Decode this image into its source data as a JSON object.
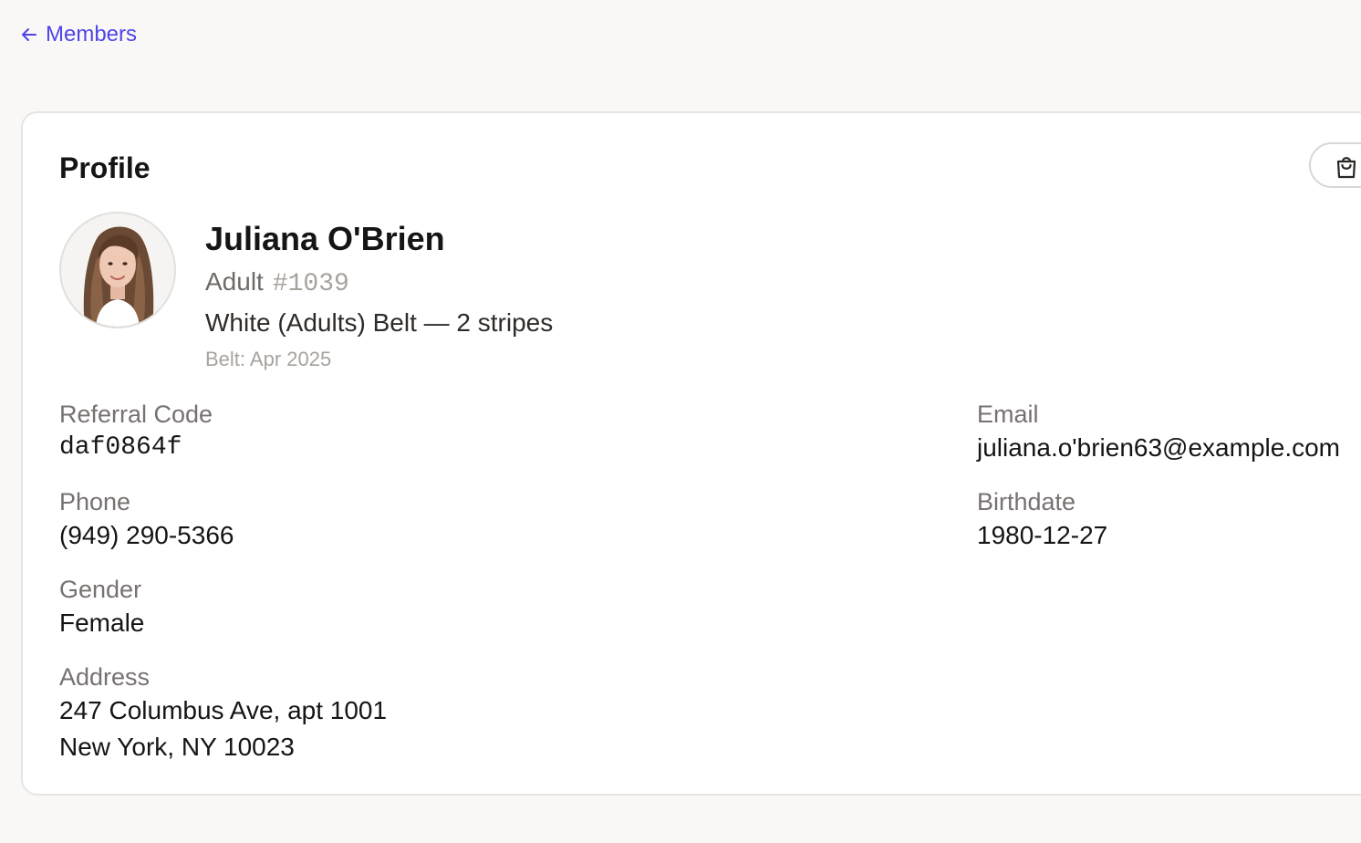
{
  "nav": {
    "back_label": "Members"
  },
  "profile": {
    "title": "Profile",
    "shop_icon": "shopping-bag-icon",
    "avatar_icon": "member-avatar",
    "name": "Juliana O'Brien",
    "type": "Adult",
    "number": "#1039",
    "belt": "White (Adults) Belt — 2 stripes",
    "belt_date": "Belt: Apr 2025"
  },
  "fields": {
    "referral_code": {
      "label": "Referral Code",
      "value": "daf0864f"
    },
    "email": {
      "label": "Email",
      "value": "juliana.o'brien63@example.com"
    },
    "phone": {
      "label": "Phone",
      "value": "(949) 290-5366"
    },
    "birthdate": {
      "label": "Birthdate",
      "value": "1980-12-27"
    },
    "gender": {
      "label": "Gender",
      "value": "Female"
    },
    "address": {
      "label": "Address",
      "line1": "247 Columbus Ave, apt 1001",
      "line2": "New York, NY 10023"
    }
  },
  "colors": {
    "accent": "#4f46e5",
    "page_bg": "#f9f8f7",
    "card_bg": "#ffffff",
    "muted_text": "#777170"
  }
}
